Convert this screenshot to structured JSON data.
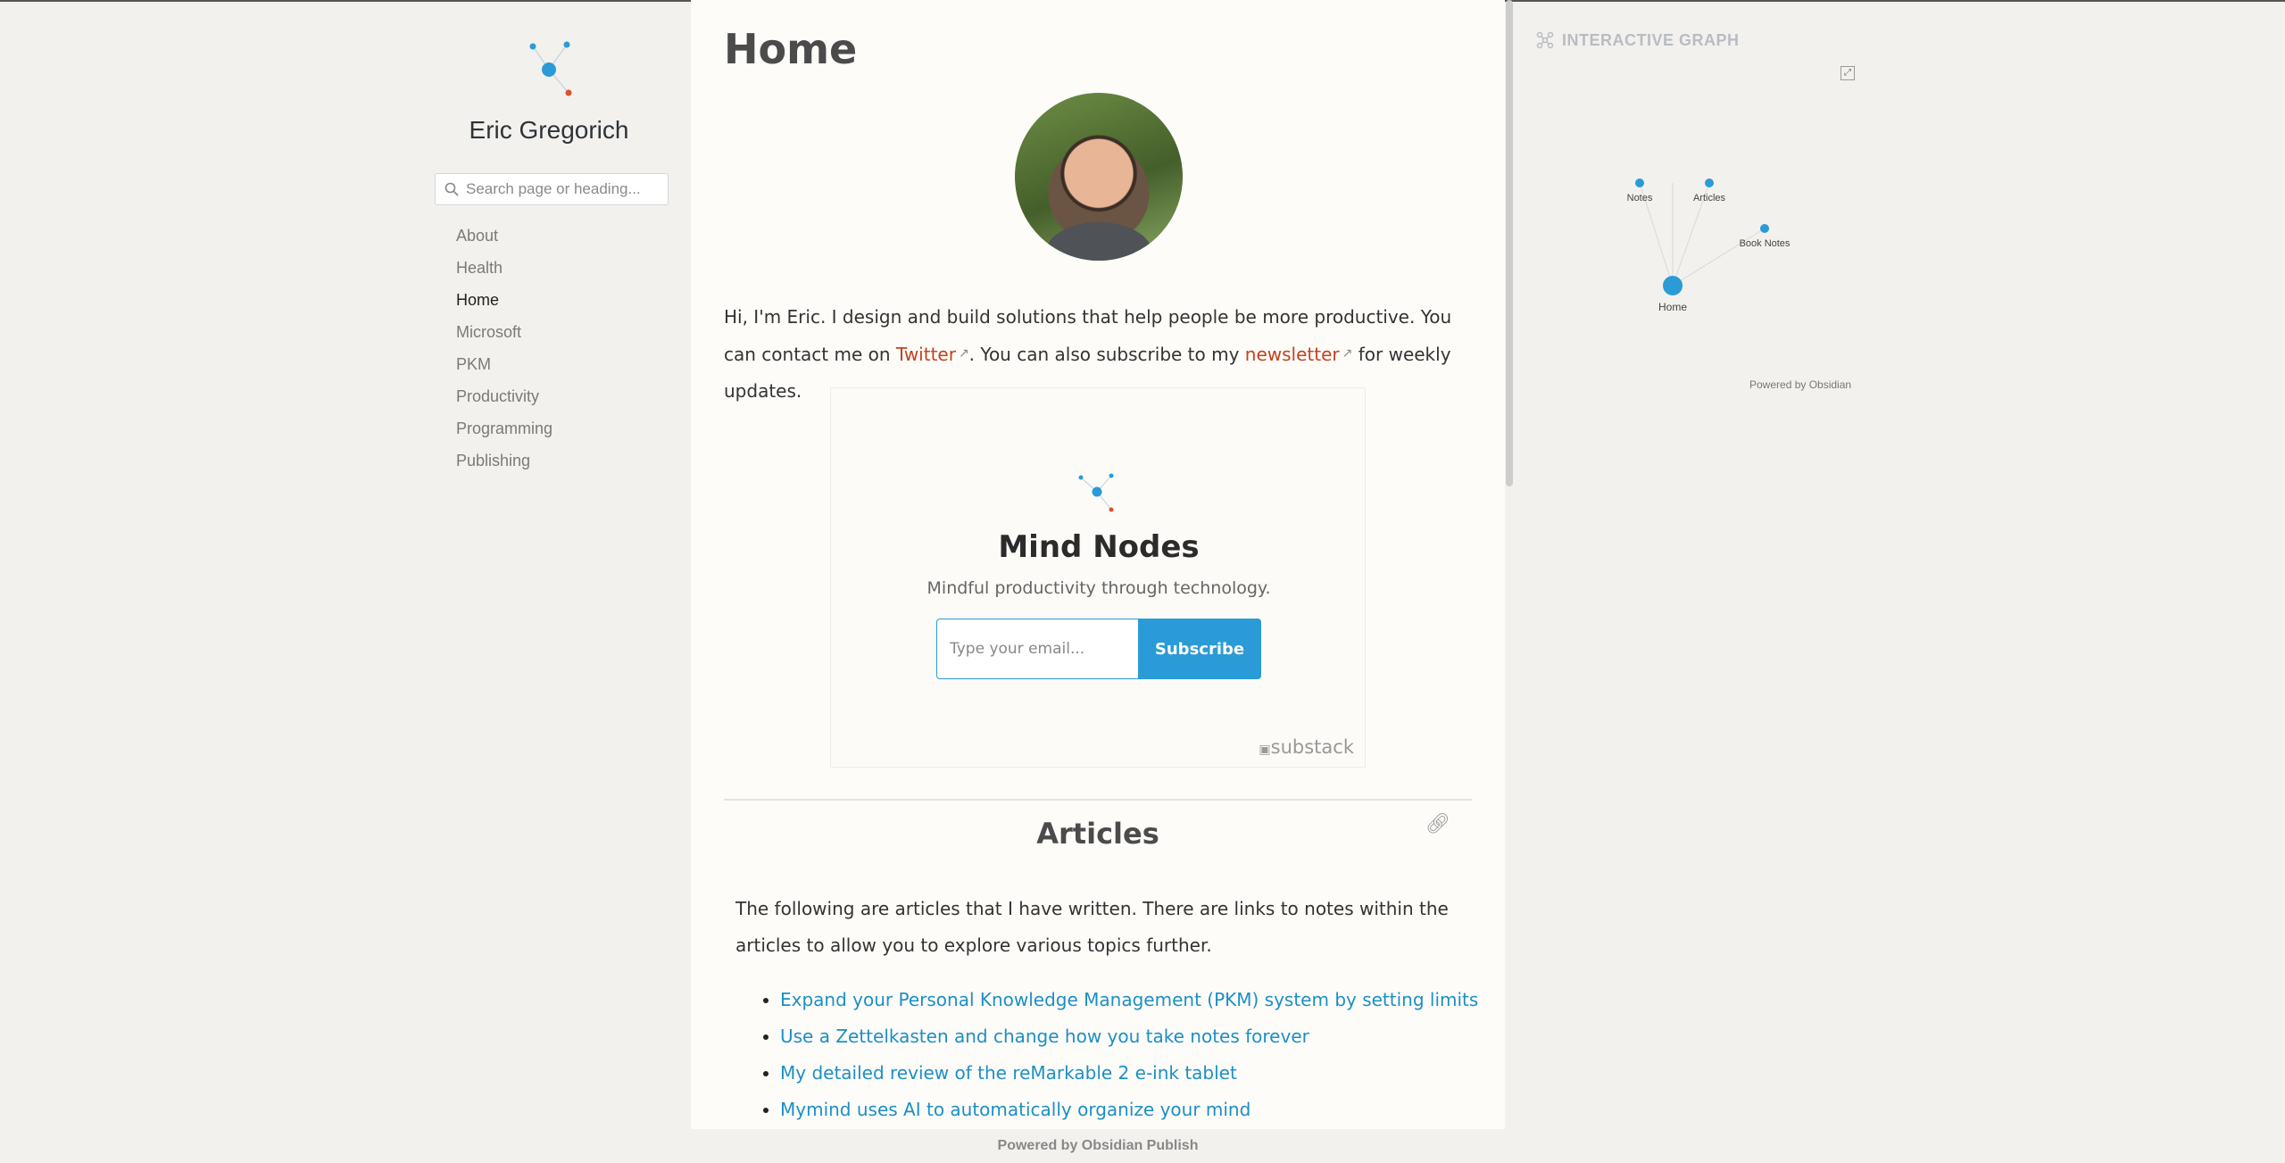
{
  "site": {
    "name": "Eric Gregorich"
  },
  "search": {
    "placeholder": "Search page or heading..."
  },
  "nav": {
    "items": [
      {
        "label": "About"
      },
      {
        "label": "Health"
      },
      {
        "label": "Home"
      },
      {
        "label": "Microsoft"
      },
      {
        "label": "PKM"
      },
      {
        "label": "Productivity"
      },
      {
        "label": "Programming"
      },
      {
        "label": "Publishing"
      }
    ],
    "active": "Home"
  },
  "page": {
    "title": "Home",
    "intro_part1": "Hi, I'm Eric. I design and build solutions that help people be more productive. You can contact me on ",
    "twitter_link": "Twitter",
    "intro_part2": ". You can also subscribe to my ",
    "newsletter_link": "newsletter",
    "intro_part3": " for weekly updates."
  },
  "embed": {
    "title": "Mind Nodes",
    "subtitle": "Mindful productivity through technology.",
    "email_placeholder": "Type your email...",
    "subscribe_label": "Subscribe",
    "brand": "substack"
  },
  "articles": {
    "heading": "Articles",
    "description": "The following are articles that I have written. There are links to notes within the articles to allow you to explore various topics further.",
    "items": [
      "Expand your Personal Knowledge Management (PKM) system by setting limits",
      "Use a Zettelkasten and change how you take notes forever",
      "My detailed review of the reMarkable 2 e-ink tablet",
      "Mymind uses AI to automatically organize your mind"
    ]
  },
  "graph": {
    "header": "INTERACTIVE GRAPH",
    "nodes": [
      "Notes",
      "Articles",
      "Book Notes",
      "Home"
    ],
    "powered": "Powered by Obsidian"
  },
  "footer": {
    "text": "Powered by Obsidian Publish"
  },
  "colors": {
    "accent": "#2a9bd6",
    "link": "#c2421e",
    "article_link": "#1d8fc4"
  }
}
